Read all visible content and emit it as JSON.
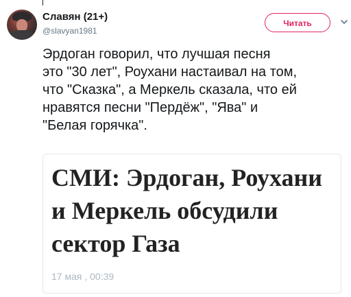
{
  "tweet": {
    "author_name": "Славян (21+)",
    "author_handle": "@slavyan1981",
    "follow_label": "Читать",
    "text": "Эрдоган говорил, что лучшая песня\nэто \"30 лет\", Роухани настаивал на том,\nчто \"Сказка\", а Меркель сказала, что ей\nнравятся песни \"Пердёж\", \"Ява\" и\n\"Белая горячка\"."
  },
  "card": {
    "title": "СМИ: Эрдоган, Роухани\nи Меркель обсудили\nсектор Газа",
    "date": "17 мая , 00:39"
  },
  "icons": {
    "menu": "chevron-down-icon",
    "avatar": "avatar-photo"
  },
  "colors": {
    "accent": "#e0245e",
    "muted": "#657786",
    "border": "#e1e8ed"
  }
}
